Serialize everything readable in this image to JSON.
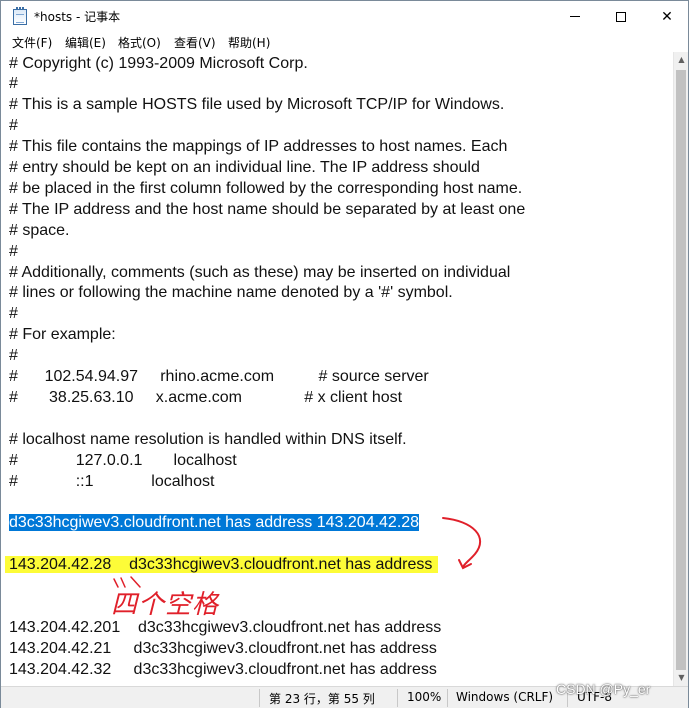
{
  "window": {
    "title": "*hosts - 记事本",
    "minimize_label": "",
    "maximize_label": "",
    "close_label": "✕"
  },
  "menu": {
    "items": [
      "文件(F)",
      "编辑(E)",
      "格式(O)",
      "查看(V)",
      "帮助(H)"
    ]
  },
  "editor": {
    "lines": [
      "# Copyright (c) 1993-2009 Microsoft Corp.",
      "#",
      "# This is a sample HOSTS file used by Microsoft TCP/IP for Windows.",
      "#",
      "# This file contains the mappings of IP addresses to host names. Each",
      "# entry should be kept on an individual line. The IP address should",
      "# be placed in the first column followed by the corresponding host name.",
      "# The IP address and the host name should be separated by at least one",
      "# space.",
      "#",
      "# Additionally, comments (such as these) may be inserted on individual",
      "# lines or following the machine name denoted by a '#' symbol.",
      "#",
      "# For example:",
      "#",
      "#      102.54.94.97     rhino.acme.com          # source server",
      "#       38.25.63.10     x.acme.com              # x client host",
      "",
      "# localhost name resolution is handled within DNS itself.",
      "#             127.0.0.1       localhost",
      "#             ::1             localhost",
      "",
      "d3c33hcgiwev3.cloudfront.net has address 143.204.42.28",
      "",
      "143.204.42.28    d3c33hcgiwev3.cloudfront.net has address",
      "",
      "",
      "143.204.42.201    d3c33hcgiwev3.cloudfront.net has address",
      "143.204.42.21     d3c33hcgiwev3.cloudfront.net has address",
      "143.204.42.32     d3c33hcgiwev3.cloudfront.net has address"
    ],
    "selected_line_index": 22,
    "highlighted_line_index": 24
  },
  "status": {
    "position": "第 23 行，第 55 列",
    "zoom": "100%",
    "line_ending": "Windows (CRLF)",
    "encoding": "UTF-8"
  },
  "annotation": {
    "handwritten_note": "四个空格",
    "note_color": "#e0202a",
    "highlight_color": "#fdfc38",
    "selection_color": "#0078d7"
  },
  "watermark": "CSDN @Py_er"
}
